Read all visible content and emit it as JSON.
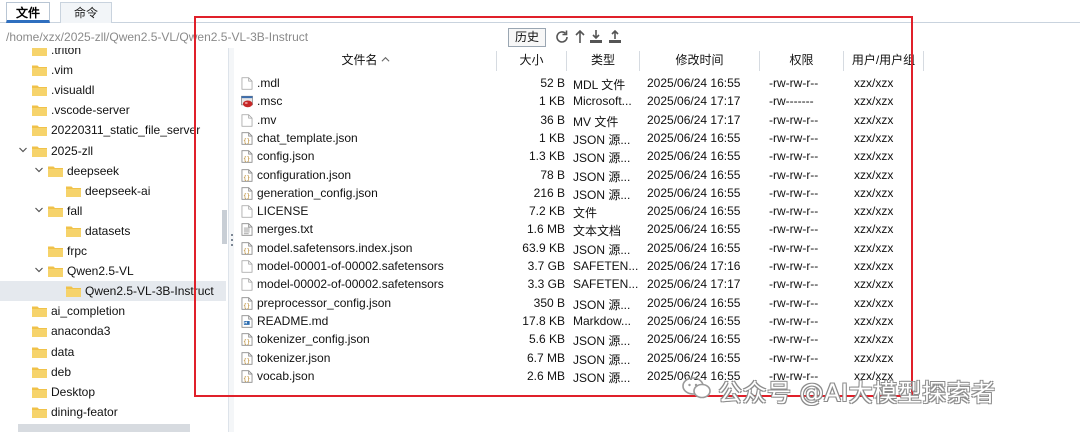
{
  "tabs": [
    {
      "label": "文件",
      "active": true
    },
    {
      "label": "命令",
      "active": false
    }
  ],
  "pathbar": {
    "path": "/home/xzx/2025-zll/Qwen2.5-VL/Qwen2.5-VL-3B-Instruct",
    "history_label": "历史",
    "icons": [
      "refresh-icon",
      "up-icon",
      "download-icon",
      "upload-icon"
    ]
  },
  "tree": {
    "items": [
      {
        "label": ".triton",
        "level": 1,
        "expanded": false,
        "selected": false
      },
      {
        "label": ".vim",
        "level": 1,
        "expanded": false,
        "selected": false
      },
      {
        "label": ".visualdl",
        "level": 1,
        "expanded": false,
        "selected": false
      },
      {
        "label": ".vscode-server",
        "level": 1,
        "expanded": false,
        "selected": false
      },
      {
        "label": "20220311_static_file_server",
        "level": 1,
        "expanded": false,
        "selected": false
      },
      {
        "label": "2025-zll",
        "level": 1,
        "expanded": true,
        "selected": false
      },
      {
        "label": "deepseek",
        "level": 2,
        "expanded": true,
        "selected": false
      },
      {
        "label": "deepseek-ai",
        "level": 3,
        "expanded": false,
        "selected": false
      },
      {
        "label": "fall",
        "level": 2,
        "expanded": true,
        "selected": false
      },
      {
        "label": "datasets",
        "level": 3,
        "expanded": false,
        "selected": false
      },
      {
        "label": "frpc",
        "level": 2,
        "expanded": false,
        "selected": false
      },
      {
        "label": "Qwen2.5-VL",
        "level": 2,
        "expanded": true,
        "selected": false
      },
      {
        "label": "Qwen2.5-VL-3B-Instruct",
        "level": 3,
        "expanded": false,
        "selected": true
      },
      {
        "label": "ai_completion",
        "level": 1,
        "expanded": false,
        "selected": false
      },
      {
        "label": "anaconda3",
        "level": 1,
        "expanded": false,
        "selected": false
      },
      {
        "label": "data",
        "level": 1,
        "expanded": false,
        "selected": false
      },
      {
        "label": "deb",
        "level": 1,
        "expanded": false,
        "selected": false
      },
      {
        "label": "Desktop",
        "level": 1,
        "expanded": false,
        "selected": false
      },
      {
        "label": "dining-feator",
        "level": 1,
        "expanded": false,
        "selected": false
      }
    ]
  },
  "filelist": {
    "columns": [
      {
        "label": "文件名",
        "sort": "asc"
      },
      {
        "label": "大小"
      },
      {
        "label": "类型"
      },
      {
        "label": "修改时间"
      },
      {
        "label": "权限"
      },
      {
        "label": "用户/用户组"
      }
    ],
    "rows": [
      {
        "name": ".mdl",
        "size": "52 B",
        "type": "MDL 文件",
        "mtime": "2025/06/24 16:55",
        "perm": "-rw-rw-r--",
        "owner": "xzx/xzx",
        "icon": "blank-file-icon"
      },
      {
        "name": ".msc",
        "size": "1 KB",
        "type": "Microsoft...",
        "mtime": "2025/06/24 17:17",
        "perm": "-rw-------",
        "owner": "xzx/xzx",
        "icon": "msc-file-icon"
      },
      {
        "name": ".mv",
        "size": "36 B",
        "type": "MV 文件",
        "mtime": "2025/06/24 17:17",
        "perm": "-rw-rw-r--",
        "owner": "xzx/xzx",
        "icon": "blank-file-icon"
      },
      {
        "name": "chat_template.json",
        "size": "1 KB",
        "type": "JSON 源...",
        "mtime": "2025/06/24 16:55",
        "perm": "-rw-rw-r--",
        "owner": "xzx/xzx",
        "icon": "json-file-icon"
      },
      {
        "name": "config.json",
        "size": "1.3 KB",
        "type": "JSON 源...",
        "mtime": "2025/06/24 16:55",
        "perm": "-rw-rw-r--",
        "owner": "xzx/xzx",
        "icon": "json-file-icon"
      },
      {
        "name": "configuration.json",
        "size": "78 B",
        "type": "JSON 源...",
        "mtime": "2025/06/24 16:55",
        "perm": "-rw-rw-r--",
        "owner": "xzx/xzx",
        "icon": "json-file-icon"
      },
      {
        "name": "generation_config.json",
        "size": "216 B",
        "type": "JSON 源...",
        "mtime": "2025/06/24 16:55",
        "perm": "-rw-rw-r--",
        "owner": "xzx/xzx",
        "icon": "json-file-icon"
      },
      {
        "name": "LICENSE",
        "size": "7.2 KB",
        "type": "文件",
        "mtime": "2025/06/24 16:55",
        "perm": "-rw-rw-r--",
        "owner": "xzx/xzx",
        "icon": "blank-file-icon"
      },
      {
        "name": "merges.txt",
        "size": "1.6 MB",
        "type": "文本文档",
        "mtime": "2025/06/24 16:55",
        "perm": "-rw-rw-r--",
        "owner": "xzx/xzx",
        "icon": "text-file-icon"
      },
      {
        "name": "model.safetensors.index.json",
        "size": "63.9 KB",
        "type": "JSON 源...",
        "mtime": "2025/06/24 16:55",
        "perm": "-rw-rw-r--",
        "owner": "xzx/xzx",
        "icon": "json-file-icon"
      },
      {
        "name": "model-00001-of-00002.safetensors",
        "size": "3.7 GB",
        "type": "SAFETEN...",
        "mtime": "2025/06/24 17:16",
        "perm": "-rw-rw-r--",
        "owner": "xzx/xzx",
        "icon": "blank-file-icon"
      },
      {
        "name": "model-00002-of-00002.safetensors",
        "size": "3.3 GB",
        "type": "SAFETEN...",
        "mtime": "2025/06/24 17:17",
        "perm": "-rw-rw-r--",
        "owner": "xzx/xzx",
        "icon": "blank-file-icon"
      },
      {
        "name": "preprocessor_config.json",
        "size": "350 B",
        "type": "JSON 源...",
        "mtime": "2025/06/24 16:55",
        "perm": "-rw-rw-r--",
        "owner": "xzx/xzx",
        "icon": "json-file-icon"
      },
      {
        "name": "README.md",
        "size": "17.8 KB",
        "type": "Markdow...",
        "mtime": "2025/06/24 16:55",
        "perm": "-rw-rw-r--",
        "owner": "xzx/xzx",
        "icon": "markdown-file-icon"
      },
      {
        "name": "tokenizer_config.json",
        "size": "5.6 KB",
        "type": "JSON 源...",
        "mtime": "2025/06/24 16:55",
        "perm": "-rw-rw-r--",
        "owner": "xzx/xzx",
        "icon": "json-file-icon"
      },
      {
        "name": "tokenizer.json",
        "size": "6.7 MB",
        "type": "JSON 源...",
        "mtime": "2025/06/24 16:55",
        "perm": "-rw-rw-r--",
        "owner": "xzx/xzx",
        "icon": "json-file-icon"
      },
      {
        "name": "vocab.json",
        "size": "2.6 MB",
        "type": "JSON 源...",
        "mtime": "2025/06/24 16:55",
        "perm": "-rw-rw-r--",
        "owner": "xzx/xzx",
        "icon": "json-file-icon"
      }
    ]
  },
  "watermark": {
    "text": "公众号 @AI大模型探索者"
  },
  "colors": {
    "highlight_box": "#e0202a",
    "folder": "#f0c24a",
    "selected_row": "#e5e9ee",
    "tab_accent": "#2f6fbf"
  }
}
